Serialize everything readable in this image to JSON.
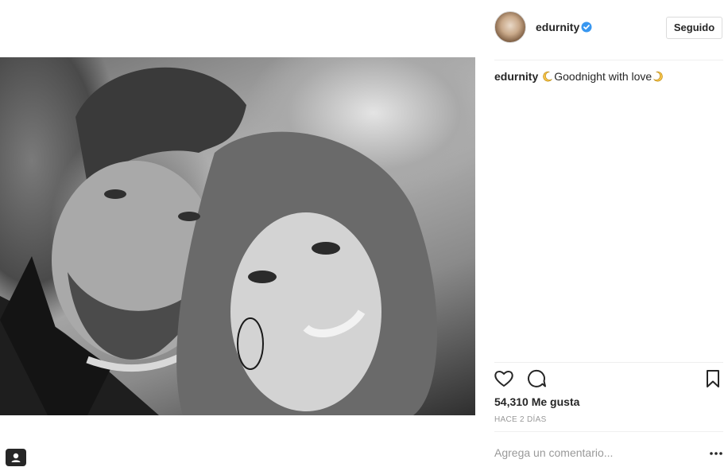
{
  "post": {
    "author": "edurnity",
    "verified": true,
    "follow_label": "Seguido",
    "caption": {
      "author": "edurnity",
      "text": "Goodnight with love",
      "emoji": "crescent-moon"
    },
    "likes_text": "54,310 Me gusta",
    "timestamp": "HACE 2 DÍAS",
    "comment_placeholder": "Agrega un comentario..."
  },
  "icons": {
    "verified": "verified-badge-icon",
    "like": "heart-icon",
    "comment": "comment-icon",
    "save": "bookmark-icon",
    "more": "more-options-icon",
    "profile": "profile-icon"
  },
  "colors": {
    "text": "#262626",
    "muted": "#999999",
    "verified_blue": "#3897f0",
    "border": "#dbdbdb",
    "moon_yellow": "#f5c24a"
  }
}
